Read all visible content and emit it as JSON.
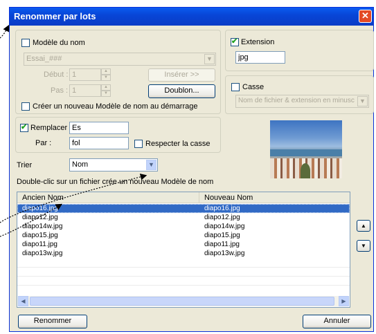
{
  "window": {
    "title": "Renommer par lots",
    "close_glyph": "✕"
  },
  "name_model": {
    "checkbox_label": "Modèle du nom",
    "checked": false,
    "pattern_value": "Essai_###",
    "start_label": "Début :",
    "start_value": "1",
    "step_label": "Pas :",
    "step_value": "1",
    "insert_button": "Insérer >>",
    "duplicate_button": "Doublon...",
    "create_at_startup_label": "Créer un nouveau Modèle de nom au démarrage",
    "create_at_startup_checked": false
  },
  "extension": {
    "checkbox_label": "Extension",
    "checked": true,
    "value": "jpg"
  },
  "case": {
    "checkbox_label": "Casse",
    "checked": false,
    "select_value": "Nom de fichier & extension en minusc"
  },
  "replace": {
    "checkbox_label": "Remplacer",
    "checked": true,
    "search_value": "Es",
    "by_label": "Par :",
    "by_value": "fol",
    "match_case_label": "Respecter la casse",
    "match_case_checked": false
  },
  "sort": {
    "label": "Trier",
    "value": "Nom"
  },
  "hint": "Double-clic sur un fichier crée un nouveau Modèle de nom",
  "file_list": {
    "columns": [
      "Ancien Nom",
      "Nouveau Nom"
    ],
    "rows": [
      {
        "old": "diapo16.jpg",
        "new": "diapo16.jpg",
        "selected": true
      },
      {
        "old": "diapo12.jpg",
        "new": "diapo12.jpg",
        "selected": false
      },
      {
        "old": "diapo14w.jpg",
        "new": "diapo14w.jpg",
        "selected": false
      },
      {
        "old": "diapo15.jpg",
        "new": "diapo15.jpg",
        "selected": false
      },
      {
        "old": "diapo11.jpg",
        "new": "diapo11.jpg",
        "selected": false
      },
      {
        "old": "diapo13w.jpg",
        "new": "diapo13w.jpg",
        "selected": false
      }
    ]
  },
  "buttons": {
    "rename": "Renommer",
    "cancel": "Annuler"
  },
  "icons": {
    "dropdown": "▼",
    "spin_up": "▲",
    "spin_down": "▼",
    "scroll_left": "◀",
    "scroll_right": "▶",
    "move_up": "▲",
    "move_down": "▼",
    "check": "✔"
  },
  "colors": {
    "title_bar": "#0a4fe0",
    "selection": "#316ac5",
    "face": "#ece9d8",
    "check_green": "#21a121"
  }
}
